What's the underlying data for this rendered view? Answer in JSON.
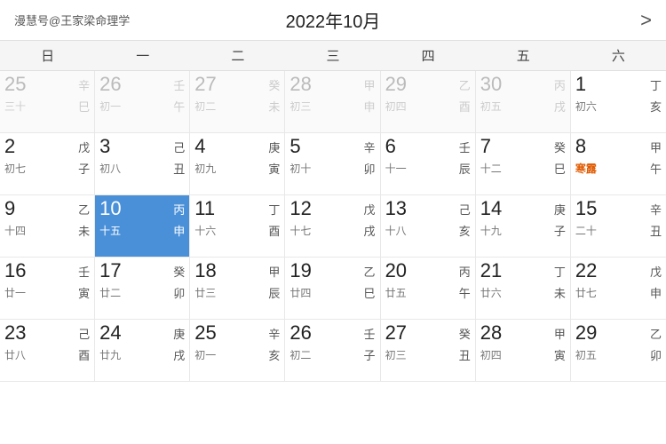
{
  "header": {
    "logo": "漫慧号@王家梁命理学",
    "title": "2022年10月",
    "nav_next": ">"
  },
  "weekdays": [
    "日",
    "一",
    "二",
    "三",
    "四",
    "五",
    "六"
  ],
  "weeks": [
    [
      {
        "solar": "25",
        "heavenly": "辛",
        "lunar": "三十",
        "earthly": "巳",
        "otherMonth": true
      },
      {
        "solar": "26",
        "heavenly": "壬",
        "lunar": "初一",
        "earthly": "午",
        "otherMonth": true
      },
      {
        "solar": "27",
        "heavenly": "癸",
        "lunar": "初二",
        "earthly": "未",
        "otherMonth": true
      },
      {
        "solar": "28",
        "heavenly": "甲",
        "lunar": "初三",
        "earthly": "申",
        "otherMonth": true
      },
      {
        "solar": "29",
        "heavenly": "乙",
        "lunar": "初四",
        "earthly": "酉",
        "otherMonth": true
      },
      {
        "solar": "30",
        "heavenly": "丙",
        "lunar": "初五",
        "earthly": "戌",
        "otherMonth": true
      },
      {
        "solar": "1",
        "heavenly": "丁",
        "lunar": "初六",
        "earthly": "亥",
        "solarTerm": "",
        "otherMonth": false
      }
    ],
    [
      {
        "solar": "2",
        "heavenly": "戊",
        "lunar": "初七",
        "earthly": "子",
        "otherMonth": false
      },
      {
        "solar": "3",
        "heavenly": "己",
        "lunar": "初八",
        "earthly": "丑",
        "otherMonth": false
      },
      {
        "solar": "4",
        "heavenly": "庚",
        "lunar": "初九",
        "earthly": "寅",
        "otherMonth": false
      },
      {
        "solar": "5",
        "heavenly": "辛",
        "lunar": "初十",
        "earthly": "卯",
        "otherMonth": false
      },
      {
        "solar": "6",
        "heavenly": "壬",
        "lunar": "十一",
        "earthly": "辰",
        "otherMonth": false
      },
      {
        "solar": "7",
        "heavenly": "癸",
        "lunar": "十二",
        "earthly": "巳",
        "otherMonth": false
      },
      {
        "solar": "8",
        "heavenly": "甲",
        "lunar": "寒露",
        "earthly": "午",
        "solarTerm": "寒露",
        "otherMonth": false
      }
    ],
    [
      {
        "solar": "9",
        "heavenly": "乙",
        "lunar": "十四",
        "earthly": "未",
        "otherMonth": false
      },
      {
        "solar": "10",
        "heavenly": "丙",
        "lunar": "十五",
        "earthly": "申",
        "otherMonth": false,
        "today": true
      },
      {
        "solar": "11",
        "heavenly": "丁",
        "lunar": "十六",
        "earthly": "酉",
        "otherMonth": false
      },
      {
        "solar": "12",
        "heavenly": "戊",
        "lunar": "十七",
        "earthly": "戌",
        "otherMonth": false
      },
      {
        "solar": "13",
        "heavenly": "己",
        "lunar": "十八",
        "earthly": "亥",
        "otherMonth": false
      },
      {
        "solar": "14",
        "heavenly": "庚",
        "lunar": "十九",
        "earthly": "子",
        "otherMonth": false
      },
      {
        "solar": "15",
        "heavenly": "辛",
        "lunar": "二十",
        "earthly": "丑",
        "otherMonth": false
      }
    ],
    [
      {
        "solar": "16",
        "heavenly": "壬",
        "lunar": "廿一",
        "earthly": "寅",
        "otherMonth": false
      },
      {
        "solar": "17",
        "heavenly": "癸",
        "lunar": "廿二",
        "earthly": "卯",
        "otherMonth": false
      },
      {
        "solar": "18",
        "heavenly": "甲",
        "lunar": "廿三",
        "earthly": "辰",
        "otherMonth": false
      },
      {
        "solar": "19",
        "heavenly": "乙",
        "lunar": "廿四",
        "earthly": "巳",
        "otherMonth": false
      },
      {
        "solar": "20",
        "heavenly": "丙",
        "lunar": "廿五",
        "earthly": "午",
        "otherMonth": false
      },
      {
        "solar": "21",
        "heavenly": "丁",
        "lunar": "廿六",
        "earthly": "未",
        "otherMonth": false
      },
      {
        "solar": "22",
        "heavenly": "戊",
        "lunar": "廿七",
        "earthly": "申",
        "otherMonth": false
      }
    ],
    [
      {
        "solar": "23",
        "heavenly": "己",
        "lunar": "廿八",
        "earthly": "酉",
        "otherMonth": false
      },
      {
        "solar": "24",
        "heavenly": "庚",
        "lunar": "廿九",
        "earthly": "戌",
        "otherMonth": false
      },
      {
        "solar": "25",
        "heavenly": "辛",
        "lunar": "初一",
        "earthly": "亥",
        "otherMonth": false
      },
      {
        "solar": "26",
        "heavenly": "壬",
        "lunar": "初二",
        "earthly": "子",
        "otherMonth": false
      },
      {
        "solar": "27",
        "heavenly": "癸",
        "lunar": "初三",
        "earthly": "丑",
        "otherMonth": false
      },
      {
        "solar": "28",
        "heavenly": "甲",
        "lunar": "初四",
        "earthly": "寅",
        "otherMonth": false
      },
      {
        "solar": "29",
        "heavenly": "乙",
        "lunar": "初五",
        "earthly": "卯",
        "otherMonth": false
      }
    ]
  ]
}
